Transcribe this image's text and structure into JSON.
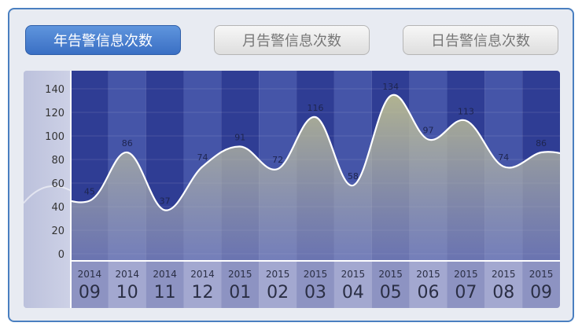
{
  "tabs": [
    {
      "label": "年告警信息次数",
      "active": true
    },
    {
      "label": "月告警信息次数",
      "active": false
    },
    {
      "label": "日告警信息次数",
      "active": false
    }
  ],
  "colors": {
    "accent": "#3a6fc4",
    "plot_dark": "#2f3d94",
    "plot_light": "#4555a8",
    "area_fill": "#c8c890",
    "line": "#ffffff"
  },
  "chart_data": {
    "type": "area",
    "categories": [
      {
        "year": "2014",
        "month": "09"
      },
      {
        "year": "2014",
        "month": "10"
      },
      {
        "year": "2014",
        "month": "11"
      },
      {
        "year": "2014",
        "month": "12"
      },
      {
        "year": "2015",
        "month": "01"
      },
      {
        "year": "2015",
        "month": "02"
      },
      {
        "year": "2015",
        "month": "03"
      },
      {
        "year": "2015",
        "month": "04"
      },
      {
        "year": "2015",
        "month": "05"
      },
      {
        "year": "2015",
        "month": "06"
      },
      {
        "year": "2015",
        "month": "07"
      },
      {
        "year": "2015",
        "month": "08"
      },
      {
        "year": "2015",
        "month": "09"
      }
    ],
    "values": [
      45,
      86,
      37,
      74,
      91,
      72,
      116,
      58,
      134,
      97,
      113,
      74,
      86
    ],
    "value_labels": [
      "45",
      "86",
      "37",
      "74",
      "91",
      "72",
      "116",
      "58",
      "134",
      "97",
      "113",
      "74",
      "86"
    ],
    "y_ticks": [
      "0",
      "20",
      "40",
      "60",
      "80",
      "100",
      "120",
      "140"
    ],
    "ylim": [
      0,
      140
    ],
    "grid": true,
    "legend": "none"
  }
}
